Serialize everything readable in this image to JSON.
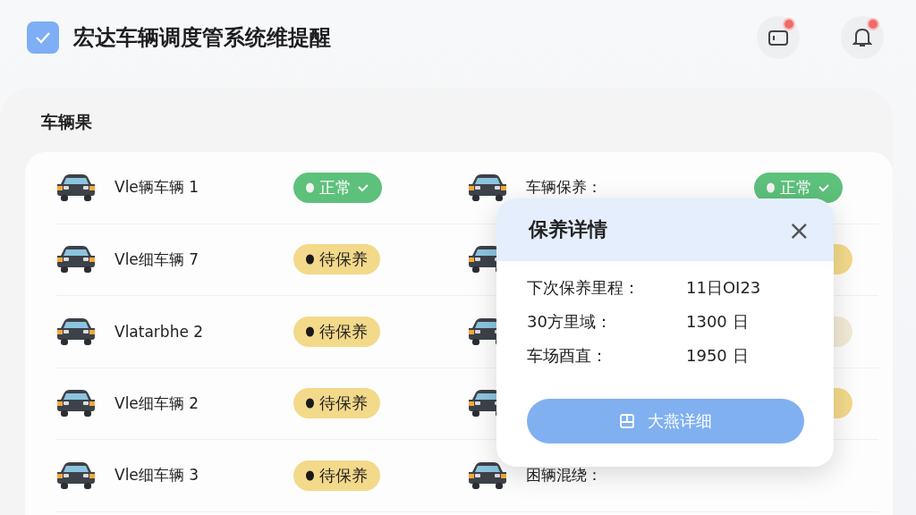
{
  "header": {
    "title": "宏达车辆调度管系统维提醒",
    "logo_checked": true,
    "notifications": [
      {
        "kind": "card",
        "unread": true
      },
      {
        "kind": "bell",
        "unread": true
      }
    ]
  },
  "panel": {
    "title": "车辆果"
  },
  "vehicles": [
    {
      "name": "Vle辆车辆 1",
      "status": {
        "kind": "normal",
        "label": "正常"
      }
    },
    {
      "name": "车辆保养：",
      "status": {
        "kind": "normal",
        "label": "正常"
      }
    },
    {
      "name": "Vle细车辆 7",
      "status": {
        "kind": "pending",
        "label": "待保养"
      }
    },
    {
      "status": {
        "kind": "pending"
      }
    },
    {
      "name": "Vlatarbhe 2",
      "status": {
        "kind": "pending",
        "label": "待保养"
      }
    },
    {
      "status": {
        "kind": "faded"
      }
    },
    {
      "name": "Vle细车辆 2",
      "status": {
        "kind": "pending",
        "label": "待保养"
      }
    },
    {
      "status": {
        "kind": "pending"
      }
    },
    {
      "name": "Vle细车辆 3",
      "status": {
        "kind": "pending",
        "label": "待保养"
      }
    },
    {
      "name": "困辆混绕："
    }
  ],
  "popup": {
    "title": "保养详情",
    "close": "×",
    "rows": [
      {
        "label": "下次保养里程：",
        "value": "11日OI23"
      },
      {
        "label": "30方里域：",
        "value": "1300 日"
      },
      {
        "label": "车场酉直：",
        "value": "1950 日"
      }
    ],
    "button": "大燕详细"
  }
}
